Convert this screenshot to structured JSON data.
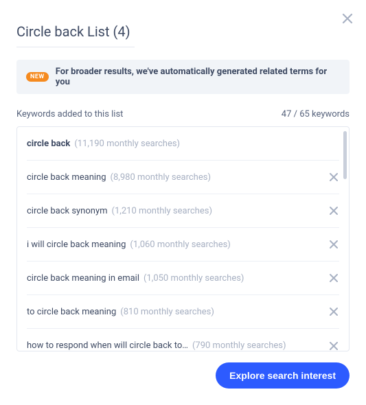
{
  "title": "Circle back List (4)",
  "banner": {
    "badge": "NEW",
    "text": "For broader results, we've automatically generated related terms for you"
  },
  "counts": {
    "label": "Keywords added to this list",
    "status": "47 / 65 keywords"
  },
  "keywords": [
    {
      "term": "circle back",
      "meta": "(11,190 monthly searches)",
      "bold": true,
      "removable": false
    },
    {
      "term": "circle back meaning",
      "meta": "(8,980 monthly searches)",
      "bold": false,
      "removable": true
    },
    {
      "term": "circle back synonym",
      "meta": "(1,210 monthly searches)",
      "bold": false,
      "removable": true
    },
    {
      "term": "i will circle back meaning",
      "meta": "(1,060 monthly searches)",
      "bold": false,
      "removable": true
    },
    {
      "term": "circle back meaning in email",
      "meta": "(1,050 monthly searches)",
      "bold": false,
      "removable": true
    },
    {
      "term": "to circle back meaning",
      "meta": "(810 monthly searches)",
      "bold": false,
      "removable": true
    },
    {
      "term": "how to respond when will circle back to…",
      "meta": "(790 monthly searches)",
      "bold": false,
      "removable": true
    }
  ],
  "cta": "Explore search interest"
}
